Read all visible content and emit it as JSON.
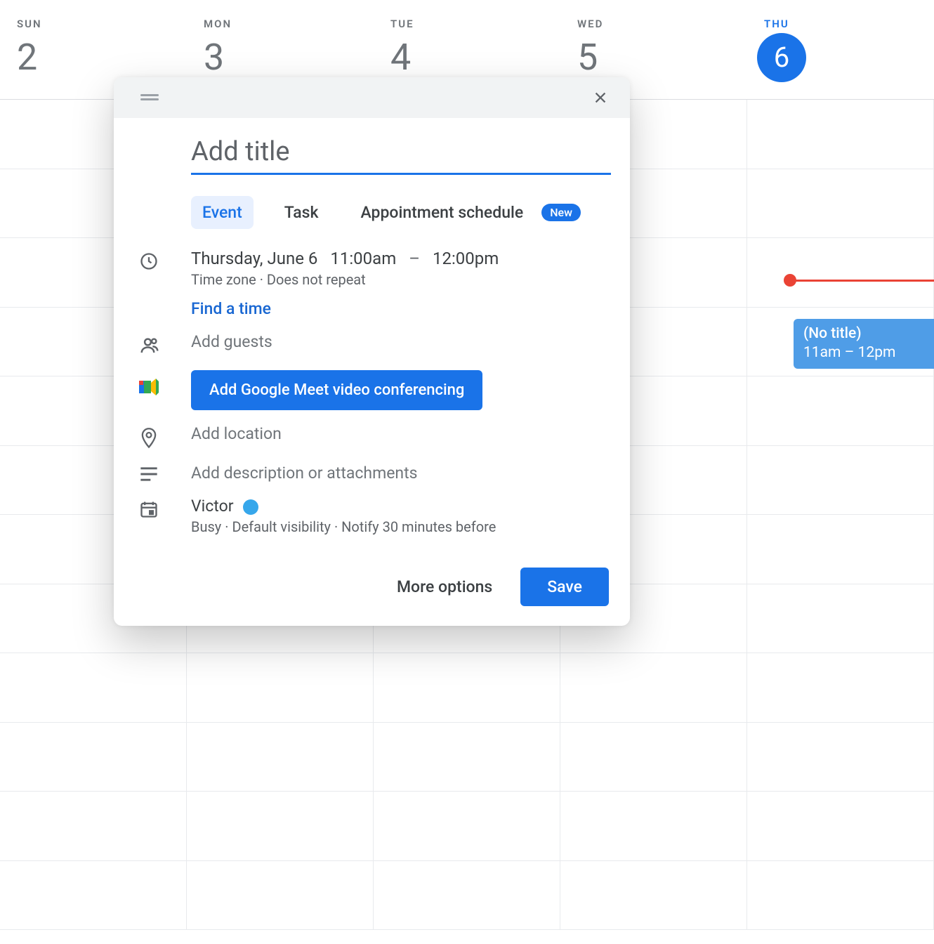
{
  "header": {
    "days": [
      {
        "label": "SUN",
        "num": "2",
        "today": false
      },
      {
        "label": "MON",
        "num": "3",
        "today": false
      },
      {
        "label": "TUE",
        "num": "4",
        "today": false
      },
      {
        "label": "WED",
        "num": "5",
        "today": false
      },
      {
        "label": "THU",
        "num": "6",
        "today": true
      }
    ]
  },
  "event_chip": {
    "title": "(No title)",
    "time": "11am – 12pm"
  },
  "dialog": {
    "title_placeholder": "Add title",
    "tabs": {
      "event": "Event",
      "task": "Task",
      "appt": "Appointment schedule",
      "new_badge": "New"
    },
    "time": {
      "date": "Thursday, June 6",
      "start": "11:00am",
      "dash": "–",
      "end": "12:00pm",
      "tz": "Time zone",
      "repeat": "Does not repeat"
    },
    "find_time": "Find a time",
    "guests_placeholder": "Add guests",
    "meet_button": "Add Google Meet video conferencing",
    "location_placeholder": "Add location",
    "desc_placeholder": "Add description or attachments",
    "calendar": {
      "name": "Victor",
      "status": "Busy",
      "visibility": "Default visibility",
      "notify": "Notify 30 minutes before"
    },
    "more_options": "More options",
    "save": "Save"
  }
}
